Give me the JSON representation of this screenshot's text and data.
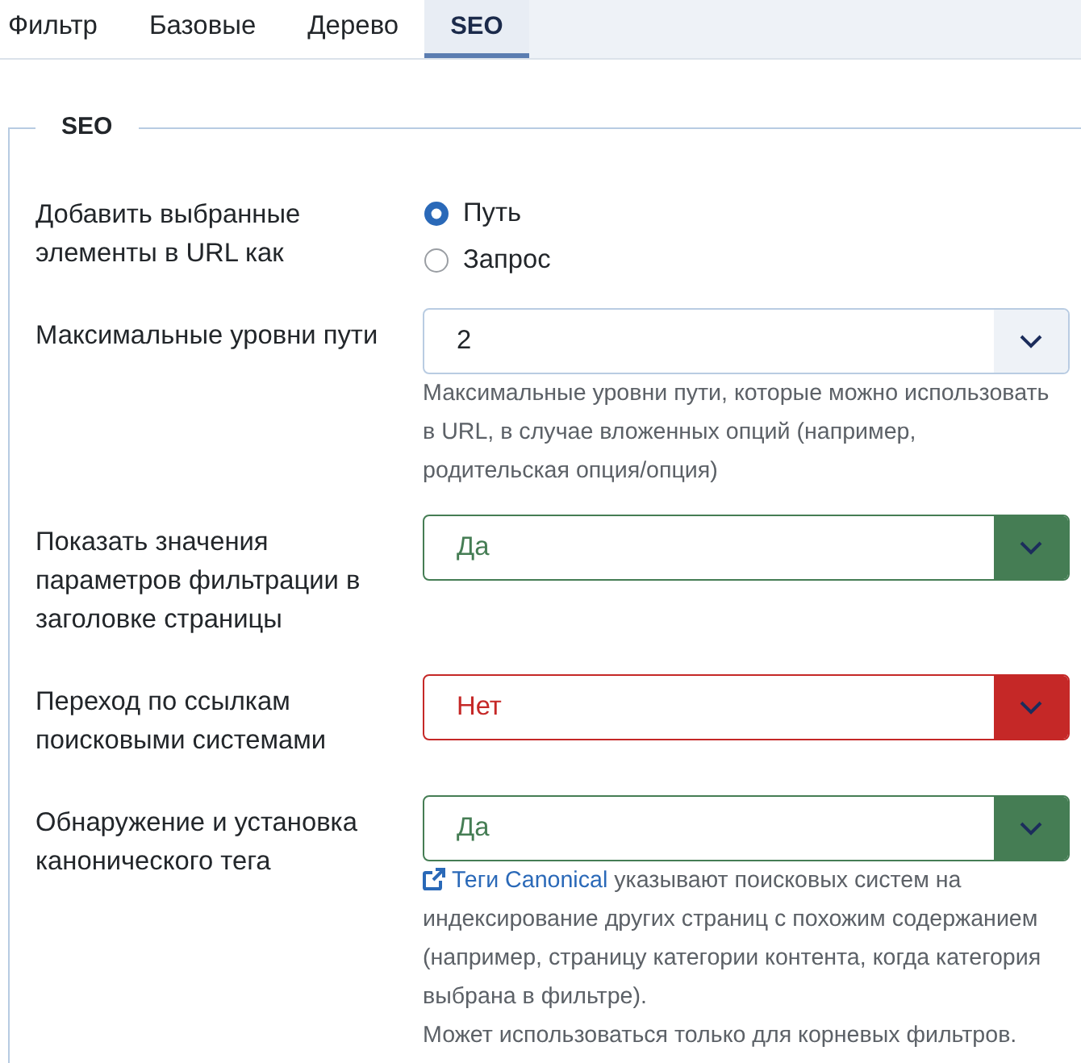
{
  "tabs": [
    {
      "label": "Фильтр",
      "selected": false
    },
    {
      "label": "Базовые",
      "selected": false
    },
    {
      "label": "Дерево",
      "selected": false
    },
    {
      "label": "SEO",
      "selected": true
    }
  ],
  "fieldset": {
    "legend": "SEO"
  },
  "fields": [
    {
      "kind": "radio",
      "label": "Добавить выбранные элементы в URL как",
      "options": [
        {
          "label": "Путь",
          "selected": true
        },
        {
          "label": "Запрос",
          "selected": false
        }
      ]
    },
    {
      "kind": "select",
      "label": "Максимальные уровни пути",
      "value": "2",
      "help": [
        {
          "text": "Максимальные уровни пути, которые можно использовать в URL, в случае вложенных опций (например, родительская опция/опция)"
        }
      ]
    },
    {
      "kind": "select",
      "label": "Показать значения параметров фильтрации в заголовке страницы",
      "value": "Да",
      "color": "#457d54"
    },
    {
      "kind": "select",
      "label": "Переход по ссылкам поисковыми системами",
      "value": "Нет",
      "color": "#c52827"
    },
    {
      "kind": "select",
      "label": "Обнаружение и установка канонического тега",
      "value": "Да",
      "color": "#457d54",
      "help": [
        {
          "link": "Теги Canonical",
          "text": "указывают поисковых систем на индексирование других страниц с похожим содержанием (например, страницу категории контента, когда категория выбрана в фильтре)."
        },
        {
          "text": "Может использоваться только для корневых фильтров."
        }
      ]
    }
  ]
}
